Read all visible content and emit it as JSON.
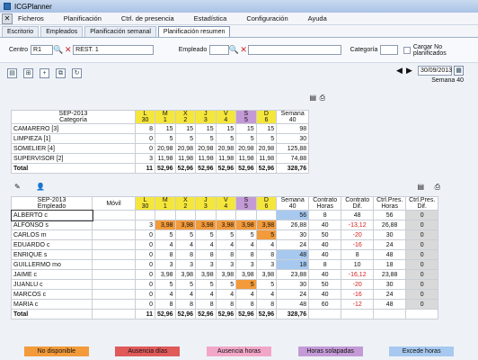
{
  "title": "ICGPlanner",
  "menu": [
    "Ficheros",
    "Planificación",
    "Ctrl. de presencia",
    "Estadística",
    "Configuración",
    "Ayuda"
  ],
  "tabs": [
    "Escritorio",
    "Empleados",
    "Planificación semanal",
    "Planificación resumen"
  ],
  "filters": {
    "centro_label": "Centro",
    "centro_code": "R1",
    "centro_name": "REST. 1",
    "empleado_label": "Empleado",
    "categoria_label": "Categoría",
    "cargar_label": "Cargar No planificados"
  },
  "date": "30/09/2013",
  "week": "Semana 40",
  "summary": {
    "header_left": "SEP-2013",
    "header_left2": "Categoría",
    "days": [
      [
        "L",
        "30"
      ],
      [
        "M",
        "1"
      ],
      [
        "X",
        "2"
      ],
      [
        "J",
        "3"
      ],
      [
        "V",
        "4"
      ],
      [
        "S",
        "5"
      ],
      [
        "D",
        "6"
      ]
    ],
    "week_col": [
      "Semana",
      "40"
    ],
    "rows": [
      [
        "CAMARERO [3]",
        "8",
        "15",
        "15",
        "15",
        "15",
        "15",
        "15",
        "98"
      ],
      [
        "LIMPIEZA [1]",
        "0",
        "5",
        "5",
        "5",
        "5",
        "5",
        "5",
        "30"
      ],
      [
        "SOMELIER [4]",
        "0",
        "20,98",
        "20,98",
        "20,98",
        "20,98",
        "20,98",
        "20,98",
        "125,88"
      ],
      [
        "SUPERVISOR [2]",
        "3",
        "11,98",
        "11,98",
        "11,98",
        "11,98",
        "11,98",
        "11,98",
        "74,88"
      ],
      [
        "Total",
        "11",
        "52,96",
        "52,96",
        "52,96",
        "52,96",
        "52,96",
        "52,96",
        "328,76"
      ]
    ]
  },
  "detail": {
    "header_left": "SEP-2013",
    "header_left2": "Empleado",
    "movil": "Móvil",
    "extra_cols": [
      [
        "Contrato",
        "Horas"
      ],
      [
        "Contrato",
        "Dif."
      ],
      [
        "Ctrl.Pres.",
        "Horas"
      ],
      [
        "Ctrl.Pres.",
        "Dif."
      ]
    ],
    "rows": [
      [
        "ALBERTO c",
        "",
        "",
        "",
        "",
        "",
        "",
        "",
        "56",
        "8",
        "48",
        "56",
        "0"
      ],
      [
        "ALFONSO s",
        "3",
        "3,98",
        "3,98",
        "3,98",
        "3,98",
        "3,98",
        "3,98",
        "26,88",
        "40",
        "-13,12",
        "26,88",
        "0"
      ],
      [
        "CARLOS m",
        "0",
        "5",
        "5",
        "5",
        "5",
        "5",
        "5",
        "30",
        "50",
        "-20",
        "30",
        "0"
      ],
      [
        "EDUARDO c",
        "0",
        "4",
        "4",
        "4",
        "4",
        "4",
        "4",
        "24",
        "40",
        "-16",
        "24",
        "0"
      ],
      [
        "ENRIQUE s",
        "0",
        "8",
        "8",
        "8",
        "8",
        "8",
        "8",
        "48",
        "40",
        "8",
        "48",
        "0"
      ],
      [
        "GUILLERMO mo",
        "0",
        "3",
        "3",
        "3",
        "3",
        "3",
        "3",
        "18",
        "8",
        "10",
        "18",
        "0"
      ],
      [
        "JAIME c",
        "0",
        "3,98",
        "3,98",
        "3,98",
        "3,98",
        "3,98",
        "3,98",
        "23,88",
        "40",
        "-16,12",
        "23,88",
        "0"
      ],
      [
        "JUANLU c",
        "0",
        "5",
        "5",
        "5",
        "5",
        "5",
        "5",
        "30",
        "50",
        "-20",
        "30",
        "0"
      ],
      [
        "MARCOS c",
        "0",
        "4",
        "4",
        "4",
        "4",
        "4",
        "4",
        "24",
        "40",
        "-16",
        "24",
        "0"
      ],
      [
        "MARIA c",
        "0",
        "8",
        "8",
        "8",
        "8",
        "8",
        "8",
        "48",
        "60",
        "-12",
        "48",
        "0"
      ],
      [
        "Total",
        "11",
        "52,96",
        "52,96",
        "52,96",
        "52,96",
        "52,96",
        "52,96",
        "328,76",
        "",
        "",
        "",
        ""
      ]
    ]
  },
  "legend": [
    "No disponible",
    "Ausencia días",
    "Ausencia horas",
    "Horas solapadas",
    "Excede horas"
  ],
  "colors": {
    "no_disponible": "#f39a3a",
    "ausencia_dias": "#e05a5a",
    "ausencia_horas": "#f2a7c8",
    "horas_solapadas": "#c49ad6",
    "excede_horas": "#a7c9ef"
  }
}
